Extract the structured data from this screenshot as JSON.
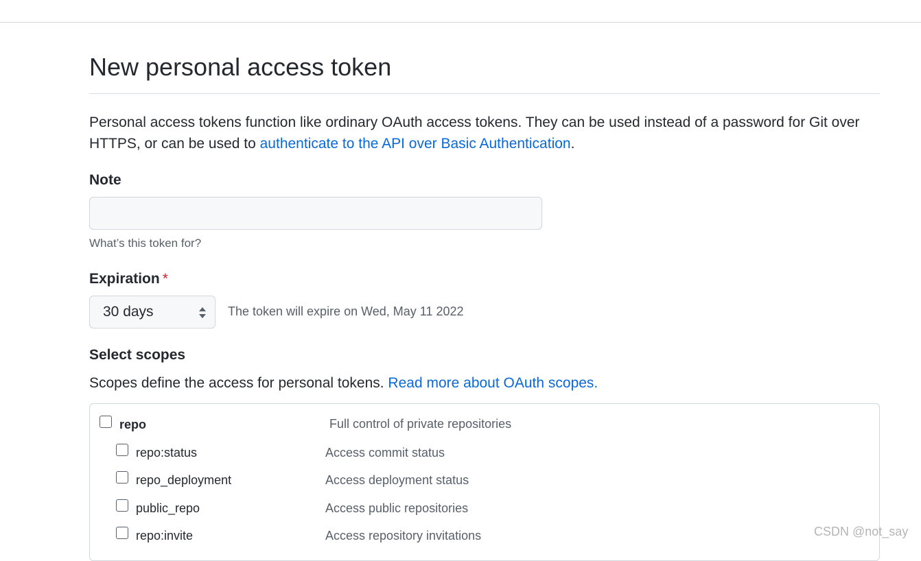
{
  "page": {
    "title": "New personal access token"
  },
  "intro": {
    "text_before": "Personal access tokens function like ordinary OAuth access tokens. They can be used instead of a password for Git over HTTPS, or can be used to ",
    "link_text": "authenticate to the API over Basic Authentication",
    "text_after": "."
  },
  "note": {
    "label": "Note",
    "value": "",
    "hint": "What’s this token for?"
  },
  "expiration": {
    "label": "Expiration",
    "required_marker": "*",
    "selected": "30 days",
    "expire_note": "The token will expire on Wed, May 11 2022"
  },
  "scopes": {
    "label": "Select scopes",
    "desc_text": "Scopes define the access for personal tokens. ",
    "desc_link": "Read more about OAuth scopes.",
    "items": [
      {
        "name": "repo",
        "desc": "Full control of private repositories",
        "checked": false,
        "parent": true
      },
      {
        "name": "repo:status",
        "desc": "Access commit status",
        "checked": false,
        "parent": false
      },
      {
        "name": "repo_deployment",
        "desc": "Access deployment status",
        "checked": false,
        "parent": false
      },
      {
        "name": "public_repo",
        "desc": "Access public repositories",
        "checked": false,
        "parent": false
      },
      {
        "name": "repo:invite",
        "desc": "Access repository invitations",
        "checked": false,
        "parent": false
      }
    ]
  },
  "watermark": "CSDN @not_say",
  "colors": {
    "link": "#0969da",
    "required": "#cf222e",
    "muted": "#57606a",
    "border": "#d0d7de"
  }
}
